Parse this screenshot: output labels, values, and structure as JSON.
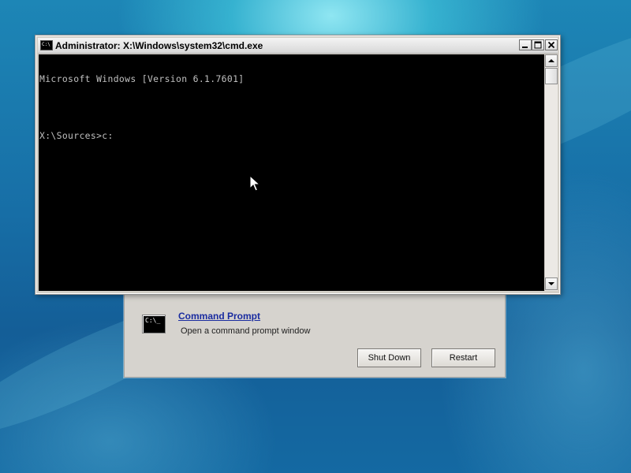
{
  "cmd_window": {
    "title": "Administrator: X:\\Windows\\system32\\cmd.exe",
    "title_icon_text": "C:\\",
    "console_lines": [
      "Microsoft Windows [Version 6.1.7601]",
      "",
      "X:\\Sources>c:"
    ],
    "controls": {
      "minimize_icon": "minimize-icon",
      "maximize_icon": "maximize-icon",
      "close_icon": "close-icon"
    }
  },
  "recovery_panel": {
    "item_icon_text": "C:\\_",
    "item_title": "Command Prompt",
    "item_description": "Open a command prompt window",
    "shutdown_label": "Shut Down",
    "restart_label": "Restart"
  },
  "colors": {
    "console_bg": "#000000",
    "console_text": "#c0c0c0",
    "link": "#1a2ca0",
    "panel_bg": "#d6d3ce"
  }
}
